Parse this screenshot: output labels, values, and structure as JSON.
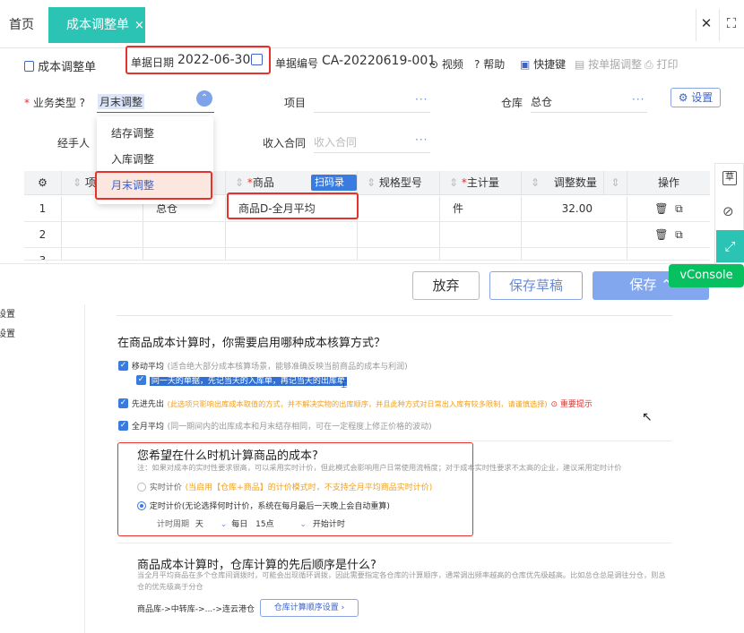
{
  "tabs": {
    "home": "首页",
    "active": "成本调整单",
    "close_glyph": "×"
  },
  "window": {
    "close": "✕",
    "expand": "⛶"
  },
  "form": {
    "title": "成本调整单",
    "date_label": "单据日期",
    "date_value": "2022-06-30",
    "code_label": "单据编号",
    "code_value": "CA-20220619-001",
    "toolbar": {
      "video": "视频",
      "help": "帮助",
      "shortcut": "快捷键",
      "adjust_by_doc": "按单据调整",
      "print": "打印"
    },
    "biz_type_label": "业务类型",
    "biz_type_value": "月末调整",
    "project_label": "项目",
    "warehouse_label": "仓库",
    "warehouse_value": "总仓",
    "settings_label": "设置",
    "handler_label": "经手人",
    "contract_label": "收入合同",
    "contract_placeholder": "收入合同",
    "dots": "···"
  },
  "dropdown": {
    "options": [
      "结存调整",
      "入库调整",
      "月末调整"
    ],
    "selected": "月末调整"
  },
  "grid": {
    "headers": {
      "project": "项",
      "product": "商品",
      "scan": "扫码录入",
      "spec": "规格型号",
      "unit": "主计量",
      "qty": "调整数量",
      "ops": "操作"
    },
    "rows": [
      {
        "no": "1",
        "warehouse": "总仓",
        "product": "商品D-全月平均",
        "unit": "件",
        "qty": "32.00"
      },
      {
        "no": "2",
        "warehouse": "",
        "product": "",
        "unit": "",
        "qty": ""
      },
      {
        "no": "3",
        "warehouse": "",
        "product": "",
        "unit": "",
        "qty": ""
      }
    ]
  },
  "footer": {
    "discard": "放弃",
    "save_draft": "保存草稿",
    "save": "保存"
  },
  "vconsole": "vConsole",
  "side_float": {
    "draft": "草"
  },
  "lower": {
    "left_items": [
      "设置",
      "设置"
    ],
    "q1_title": "在商品成本计算时，你需要启用哪种成本核算方式？",
    "opt_moving": "移动平均",
    "opt_moving_desc": "(适合绝大部分成本核算场景，能够准确反映当前商品的成本与利润)",
    "opt_moving_sub": "同一天的单据，先记当天的入库单，再记当天的出库单",
    "opt_fifo": "先进先出",
    "opt_fifo_desc": "(此选项只影响出库成本取值的方式，并不解决实物的出库顺序，并且此种方式对日常出入库有较多限制，请谨慎选择)",
    "opt_fifo_tip": "重要提示",
    "opt_monthly": "全月平均",
    "opt_monthly_desc": "(同一期间内的出库成本和月末结存相同，可在一定程度上修正价格的波动)",
    "q2_title": "您希望在什么时机计算商品的成本?",
    "q2_note": "注：如果对成本的实时性要求很高，可以采用实时计价，但此模式会影响用户日常使用流畅度；对于成本实时性要求不太高的企业，建议采用定时计价",
    "realtime": "实时计价",
    "realtime_desc": "(当启用【仓库+商品】的计价模式时，不支持全月平均商品实时计价)",
    "scheduled": "定时计价(无论选择何时计价，系统在每月最后一天晚上会自动重算)",
    "period_label": "计时周期",
    "period_value": "天",
    "every_day": "每日",
    "hour": "15点",
    "start": "开始计时",
    "q3_title": "商品成本计算时，仓库计算的先后顺序是什么?",
    "q3_note": "当全月平均商品在多个仓库间调拨时，可能会出现循环调拨，因此需要指定各仓库的计算顺序，通常调出频率越高的仓库优先级越高。比如总仓总是调往分仓，则总仓的优先级高于分仓",
    "route": "商品库->中转库->...->连云港仓",
    "route_btn": "仓库计算顺序设置"
  }
}
